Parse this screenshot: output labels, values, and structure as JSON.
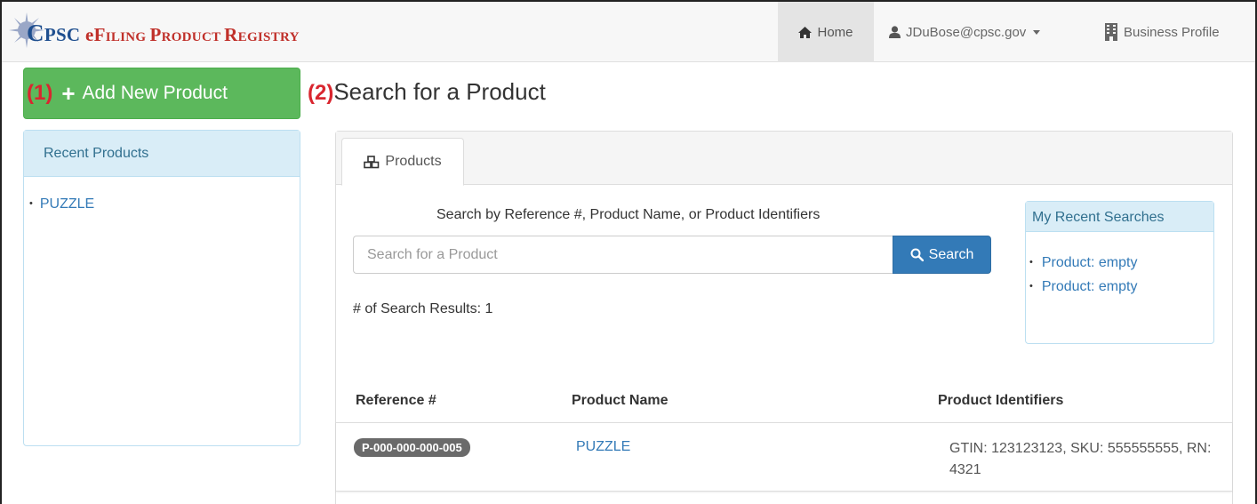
{
  "brand": {
    "title_c": "C",
    "title_rest1": "PSC ",
    "title_e": "e",
    "title_f": "F",
    "title_iling": "ILING ",
    "title_p": "P",
    "title_roduct": "RODUCT ",
    "title_r": "R",
    "title_egistry": "EGISTRY"
  },
  "nav": {
    "home": "Home",
    "user": "JDuBose@cpsc.gov",
    "business": "Business Profile"
  },
  "add_button": {
    "step": "(1)",
    "label": "Add New Product"
  },
  "recent_products": {
    "title": "Recent Products",
    "items": [
      "PUZZLE"
    ]
  },
  "page": {
    "step": "(2)",
    "title": "Search for a Product"
  },
  "tabs": [
    {
      "label": "Products",
      "icon": "cubes-icon"
    }
  ],
  "search": {
    "caption": "Search by Reference #, Product Name, or Product Identifiers",
    "placeholder": "Search for a Product",
    "value": "",
    "button": "Search",
    "result_count": "# of Search Results: 1"
  },
  "recent_searches": {
    "title": "My Recent Searches",
    "items": [
      "Product: empty",
      "Product: empty"
    ]
  },
  "table": {
    "columns": [
      "Reference #",
      "Product Name",
      "Product Identifiers"
    ],
    "rows": [
      {
        "reference": "P-000-000-000-005",
        "name": "PUZZLE",
        "identifiers": "GTIN: 123123123, SKU: 555555555, RN: 4321"
      }
    ]
  },
  "colors": {
    "success": "#5cb85c",
    "primary": "#337ab7",
    "info_bg": "#d9edf7",
    "step_red": "#d9262f",
    "brand_blue": "#1f4f8f"
  }
}
